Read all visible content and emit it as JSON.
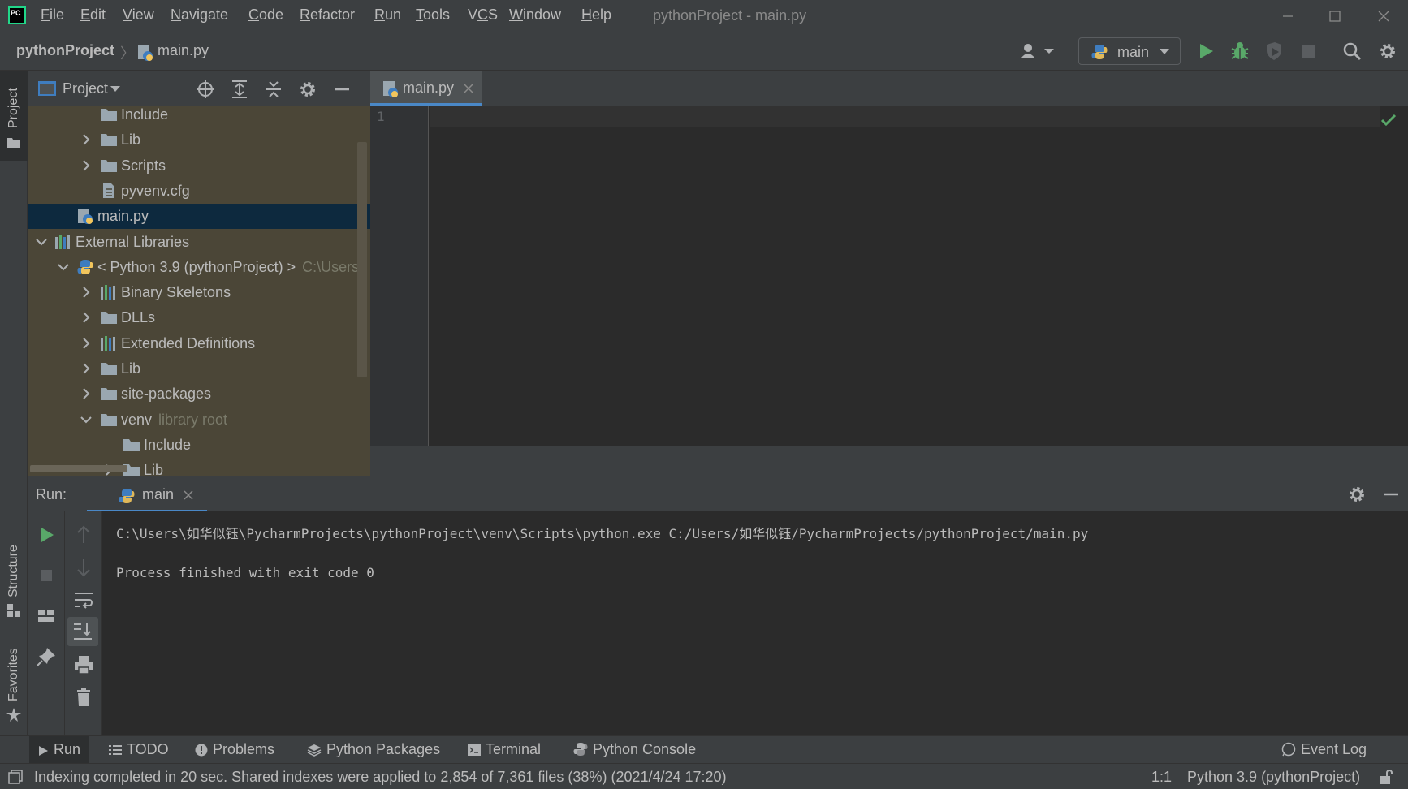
{
  "window": {
    "title": "pythonProject - main.py",
    "app_logo": "PC"
  },
  "menu": [
    {
      "label": "File",
      "mnemonic_index": 0
    },
    {
      "label": "Edit",
      "mnemonic_index": 0
    },
    {
      "label": "View",
      "mnemonic_index": 0
    },
    {
      "label": "Navigate",
      "mnemonic_index": 0
    },
    {
      "label": "Code",
      "mnemonic_index": 0
    },
    {
      "label": "Refactor",
      "mnemonic_index": 0
    },
    {
      "label": "Run",
      "mnemonic_index": 0
    },
    {
      "label": "Tools",
      "mnemonic_index": 0
    },
    {
      "label": "VCS",
      "mnemonic_index": 1
    },
    {
      "label": "Window",
      "mnemonic_index": 0
    },
    {
      "label": "Help",
      "mnemonic_index": 0
    }
  ],
  "navbar": {
    "project": "pythonProject",
    "separator": "〉",
    "file": "main.py",
    "run_config": "main"
  },
  "left_strip": {
    "project_tab": "Project",
    "structure_tab": "Structure",
    "favorites_tab": "Favorites"
  },
  "project_panel": {
    "title": "Project",
    "tree": [
      {
        "label": "Include",
        "icon": "folder-icon",
        "indent": 2,
        "expand": "none"
      },
      {
        "label": "Lib",
        "icon": "folder-icon",
        "indent": 2,
        "expand": "collapsed"
      },
      {
        "label": "Scripts",
        "icon": "folder-icon",
        "indent": 2,
        "expand": "collapsed"
      },
      {
        "label": "pyvenv.cfg",
        "icon": "file-text-icon",
        "indent": 2,
        "expand": "none"
      },
      {
        "label": "main.py",
        "icon": "python-file-icon",
        "indent": 1,
        "expand": "none",
        "selected": true
      },
      {
        "label": "External Libraries",
        "icon": "library-icon",
        "indent": 0,
        "expand": "expanded"
      },
      {
        "label": "< Python 3.9 (pythonProject) >",
        "hint": "C:\\Users",
        "icon": "python-icon",
        "indent": 1,
        "expand": "expanded"
      },
      {
        "label": "Binary Skeletons",
        "icon": "library-icon",
        "indent": 2,
        "expand": "collapsed"
      },
      {
        "label": "DLLs",
        "icon": "folder-icon",
        "indent": 2,
        "expand": "collapsed"
      },
      {
        "label": "Extended Definitions",
        "icon": "library-icon",
        "indent": 2,
        "expand": "collapsed"
      },
      {
        "label": "Lib",
        "icon": "folder-icon",
        "indent": 2,
        "expand": "collapsed"
      },
      {
        "label": "site-packages",
        "icon": "folder-icon",
        "indent": 2,
        "expand": "collapsed"
      },
      {
        "label": "venv",
        "hint": "library root",
        "icon": "folder-icon",
        "indent": 2,
        "expand": "expanded"
      },
      {
        "label": "Include",
        "icon": "folder-icon",
        "indent": 3,
        "expand": "none"
      },
      {
        "label": "Lib",
        "icon": "folder-icon",
        "indent": 3,
        "expand": "collapsed"
      }
    ]
  },
  "editor": {
    "tab_label": "main.py",
    "line_numbers": [
      "1"
    ]
  },
  "run_panel": {
    "label": "Run:",
    "tab_label": "main",
    "console_lines": [
      "C:\\Users\\如华似钰\\PycharmProjects\\pythonProject\\venv\\Scripts\\python.exe C:/Users/如华似钰/PycharmProjects/pythonProject/main.py",
      "",
      "Process finished with exit code 0"
    ]
  },
  "bottom_tabs": {
    "run": "Run",
    "todo": "TODO",
    "problems": "Problems",
    "python_packages": "Python Packages",
    "terminal": "Terminal",
    "python_console": "Python Console",
    "event_log": "Event Log"
  },
  "status": {
    "message": "Indexing completed in 20 sec. Shared indexes were applied to 2,854 of 7,361 files (38%) (2021/4/24 17:20)",
    "position": "1:1",
    "interpreter": "Python 3.9 (pythonProject)"
  },
  "colors": {
    "accent": "#4a88c7",
    "run_green": "#59a869",
    "tree_bg": "#4b4637",
    "selection": "#0d293e"
  }
}
